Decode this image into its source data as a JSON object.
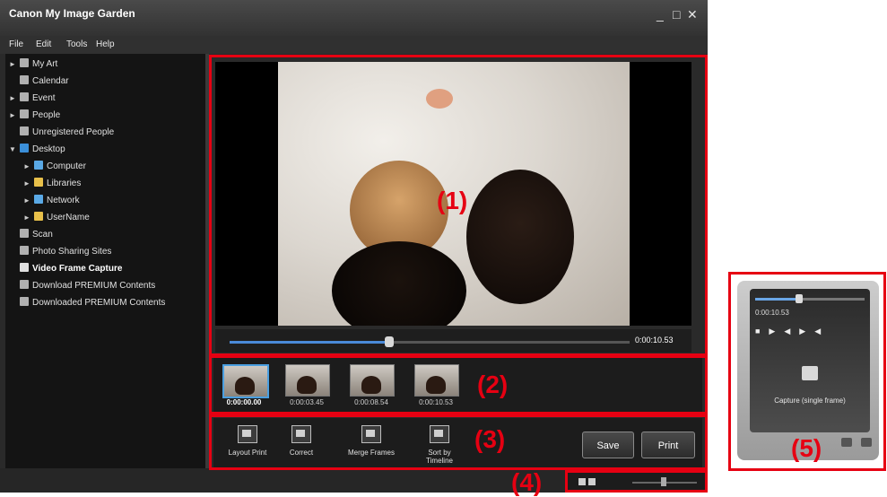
{
  "app": {
    "title": "Canon My Image Garden"
  },
  "window_controls": {
    "minimize": "_",
    "maximize": "□",
    "close": "✕"
  },
  "menu": [
    "File",
    "Edit",
    "Tools",
    "Help"
  ],
  "sidebar": {
    "items": [
      {
        "label": "My Art",
        "arrow": "►"
      },
      {
        "label": "Calendar",
        "arrow": ""
      },
      {
        "label": "Event",
        "arrow": "►"
      },
      {
        "label": "People",
        "arrow": "►"
      },
      {
        "label": "Unregistered People",
        "arrow": ""
      },
      {
        "label": "Desktop",
        "arrow": "▼"
      },
      {
        "label": "Computer",
        "arrow": "►"
      },
      {
        "label": "Libraries",
        "arrow": "►"
      },
      {
        "label": "Network",
        "arrow": "►"
      },
      {
        "label": "UserName",
        "arrow": "►"
      },
      {
        "label": "Scan",
        "arrow": ""
      },
      {
        "label": "Photo Sharing Sites",
        "arrow": ""
      },
      {
        "label": "Video Frame Capture",
        "arrow": ""
      },
      {
        "label": "Download PREMIUM Contents",
        "arrow": ""
      },
      {
        "label": "Downloaded PREMIUM Contents",
        "arrow": ""
      }
    ]
  },
  "player": {
    "time": "0:00:10.53",
    "progress": 0.4
  },
  "thumbnails": [
    {
      "time": "0:00:00.00",
      "selected": true
    },
    {
      "time": "0:00:03.45",
      "selected": false
    },
    {
      "time": "0:00:08.54",
      "selected": false
    },
    {
      "time": "0:00:10.53",
      "selected": false
    }
  ],
  "toolbar": {
    "tools": [
      "Layout Print",
      "Correct",
      "Merge Frames",
      "Sort by\nTimeline"
    ],
    "save": "Save",
    "print": "Print"
  },
  "callouts": {
    "c1": "(1)",
    "c2": "(2)",
    "c3": "(3)",
    "c4": "(4)",
    "c5": "(5)"
  },
  "panel5": {
    "time": "0:00:10.53",
    "capture_label": "Capture (single frame)",
    "progress": 0.4
  },
  "colors": {
    "highlight": "#e60012",
    "accent": "#4a8ad8"
  }
}
